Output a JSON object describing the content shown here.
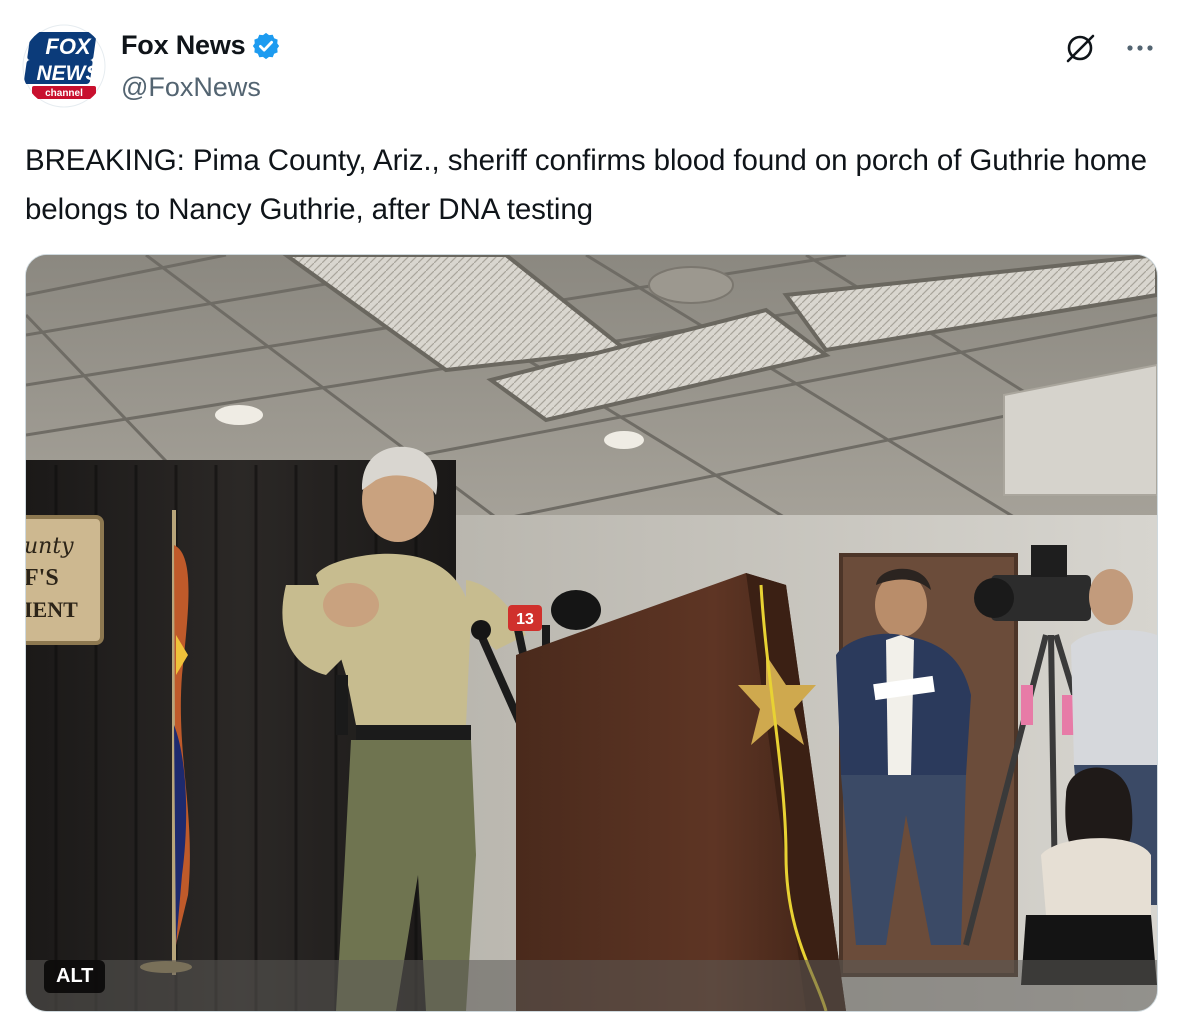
{
  "author": {
    "display_name": "Fox News",
    "handle": "@FoxNews",
    "verified": true,
    "avatar_logo": {
      "line1": "FOX",
      "line2": "NEWS",
      "line3": "channel"
    }
  },
  "actions": {
    "grok_icon": "grok-slash-circle",
    "more_icon": "ellipsis"
  },
  "tweet": {
    "text": "BREAKING: Pima County, Ariz., sheriff confirms blood found on porch of Guthrie home belongs to Nancy Guthrie, after DNA testing"
  },
  "media": {
    "alt_badge": "ALT",
    "sign_text": [
      "unty",
      "F'S",
      "IENT"
    ],
    "mic_flag": "13"
  },
  "colors": {
    "brand_blue": "#1d9bf0",
    "fox_red": "#c8102e",
    "fox_navy": "#003366",
    "text": "#0f1419",
    "muted": "#536471"
  }
}
